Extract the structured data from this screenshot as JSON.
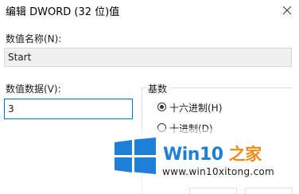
{
  "window": {
    "title": "编辑 DWORD (32 位)值"
  },
  "value_name": {
    "label": "数值名称(N):",
    "value": "Start"
  },
  "value_data": {
    "label": "数值数据(V):",
    "value": "3"
  },
  "base": {
    "label": "基数",
    "options": [
      {
        "label": "十六进制(H)",
        "selected": true
      },
      {
        "label": "十进制(D)",
        "selected": false
      }
    ]
  },
  "watermark": {
    "brand": "Win10",
    "brand_suffix": "之家",
    "url": "www.win10xitong.com"
  },
  "colors": {
    "accent": "#0078d7",
    "brand_blue": "#1e7fd6",
    "brand_orange": "#ef8a1b"
  },
  "icons": {
    "close": "close-icon",
    "logo": "windows-logo-icon"
  }
}
